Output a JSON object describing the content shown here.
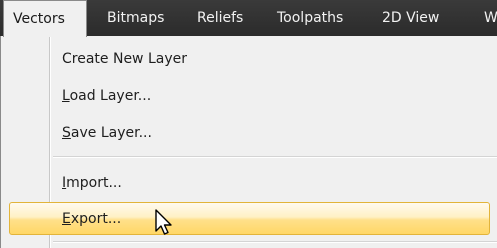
{
  "menubar": {
    "items": [
      {
        "label": "Vectors",
        "active": true
      },
      {
        "label": "Bitmaps"
      },
      {
        "label": "Reliefs"
      },
      {
        "label": "Toolpaths"
      },
      {
        "label": "2D View"
      },
      {
        "label": "W"
      }
    ]
  },
  "dropdown": {
    "items": [
      {
        "label": "Create New Layer"
      },
      {
        "mnemonic": "L",
        "rest": "oad Layer..."
      },
      {
        "mnemonic": "S",
        "rest": "ave Layer..."
      },
      {
        "mnemonic": "I",
        "rest": "mport..."
      },
      {
        "mnemonic": "E",
        "rest": "xport...",
        "highlighted": true
      }
    ]
  },
  "colors": {
    "menubar_bg": "#2f2f2f",
    "highlight_fill": "#ffe08a",
    "highlight_border": "#e2b43a"
  },
  "icons": {
    "cursor": "mouse-pointer-icon"
  }
}
